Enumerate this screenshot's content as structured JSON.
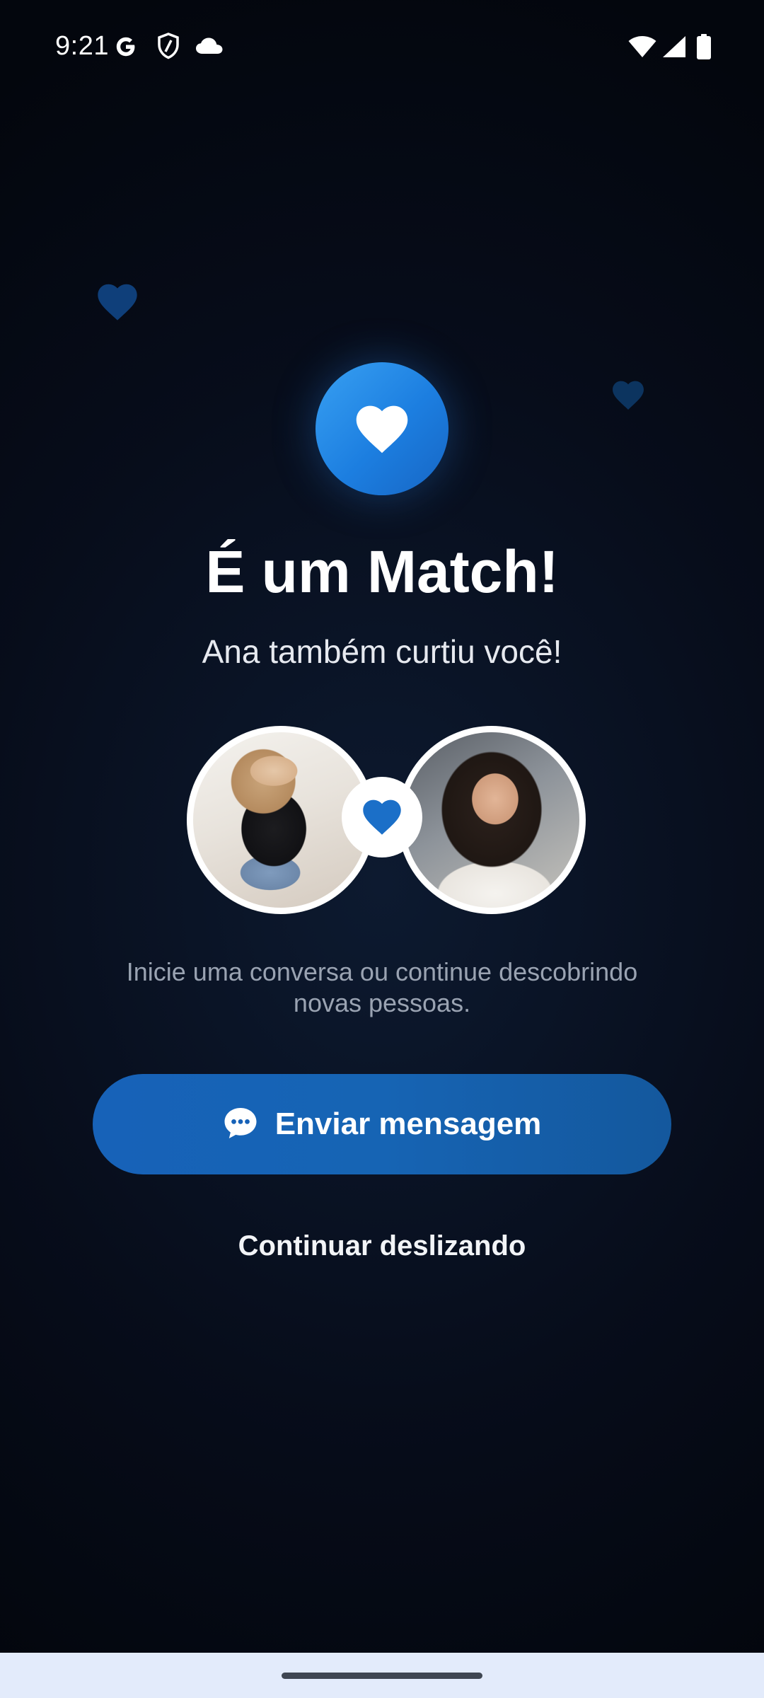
{
  "status_bar": {
    "time": "9:21",
    "icons": [
      "google-icon",
      "shield-icon",
      "cloud-icon",
      "wifi-icon",
      "signal-icon",
      "battery-icon"
    ]
  },
  "match": {
    "title": "É um Match!",
    "subtitle": "Ana também curtiu você!",
    "helper_text": "Inicie uma conversa ou continue descobrindo novas pessoas."
  },
  "actions": {
    "send_message_label": "Enviar mensagem",
    "send_message_icon": "chat-bubble-icon",
    "continue_label": "Continuar deslizando"
  },
  "colors": {
    "accent": "#1c7ee0",
    "button": "#1762b8",
    "background": "#070d1b",
    "nav_bar": "#e3ebfb"
  }
}
